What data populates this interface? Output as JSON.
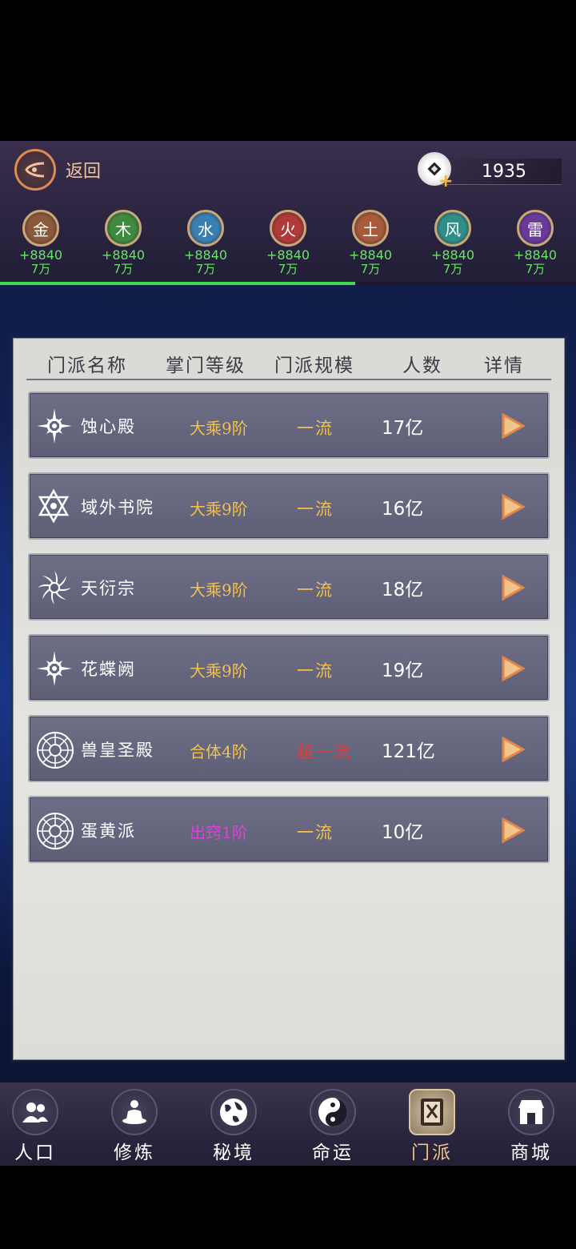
{
  "header": {
    "back_label": "返回",
    "currency_value": "1935"
  },
  "elements": [
    {
      "name": "金",
      "bonus": "+8840",
      "amount": "7万",
      "color": "#8a5a3a"
    },
    {
      "name": "木",
      "bonus": "+8840",
      "amount": "7万",
      "color": "#3f8a3f"
    },
    {
      "name": "水",
      "bonus": "+8840",
      "amount": "7万",
      "color": "#3a7fb0"
    },
    {
      "name": "火",
      "bonus": "+8840",
      "amount": "7万",
      "color": "#b03a3a"
    },
    {
      "name": "土",
      "bonus": "+8840",
      "amount": "7万",
      "color": "#a85a3a"
    },
    {
      "name": "风",
      "bonus": "+8840",
      "amount": "7万",
      "color": "#2f8f88"
    },
    {
      "name": "雷",
      "bonus": "+8840",
      "amount": "7万",
      "color": "#6a3a9a"
    }
  ],
  "progress": 0.617,
  "table": {
    "headers": [
      "门派名称",
      "掌门等级",
      "门派规模",
      "人数",
      "详情"
    ],
    "rows": [
      {
        "name": "蚀心殿",
        "level": "大乘9阶",
        "level_color": "#f2c14e",
        "scale": "一流",
        "scale_color": "#f2c14e",
        "count": "17亿",
        "icon": "sun-sigil-icon"
      },
      {
        "name": "域外书院",
        "level": "大乘9阶",
        "level_color": "#f2c14e",
        "scale": "一流",
        "scale_color": "#f2c14e",
        "count": "16亿",
        "icon": "hexagram-icon"
      },
      {
        "name": "天衍宗",
        "level": "大乘9阶",
        "level_color": "#f2c14e",
        "scale": "一流",
        "scale_color": "#f2c14e",
        "count": "18亿",
        "icon": "flame-star-icon"
      },
      {
        "name": "花蝶阙",
        "level": "大乘9阶",
        "level_color": "#f2c14e",
        "scale": "一流",
        "scale_color": "#f2c14e",
        "count": "19亿",
        "icon": "sun-sigil-icon"
      },
      {
        "name": "兽皇圣殿",
        "level": "合体4阶",
        "level_color": "#f2c14e",
        "scale": "超一流",
        "scale_color": "#e23b3b",
        "count": "121亿",
        "icon": "compass-sigil-icon"
      },
      {
        "name": "蛋黄派",
        "level": "出窍1阶",
        "level_color": "#d844d8",
        "scale": "一流",
        "scale_color": "#f2c14e",
        "count": "10亿",
        "icon": "compass-sigil-icon"
      }
    ]
  },
  "nav": [
    {
      "label": "人口",
      "icon": "people-icon"
    },
    {
      "label": "修炼",
      "icon": "meditation-icon"
    },
    {
      "label": "秘境",
      "icon": "globe-icon"
    },
    {
      "label": "命运",
      "icon": "yin-yang-icon"
    },
    {
      "label": "门派",
      "icon": "sect-book-icon",
      "active": true
    },
    {
      "label": "商城",
      "icon": "shop-icon"
    }
  ]
}
